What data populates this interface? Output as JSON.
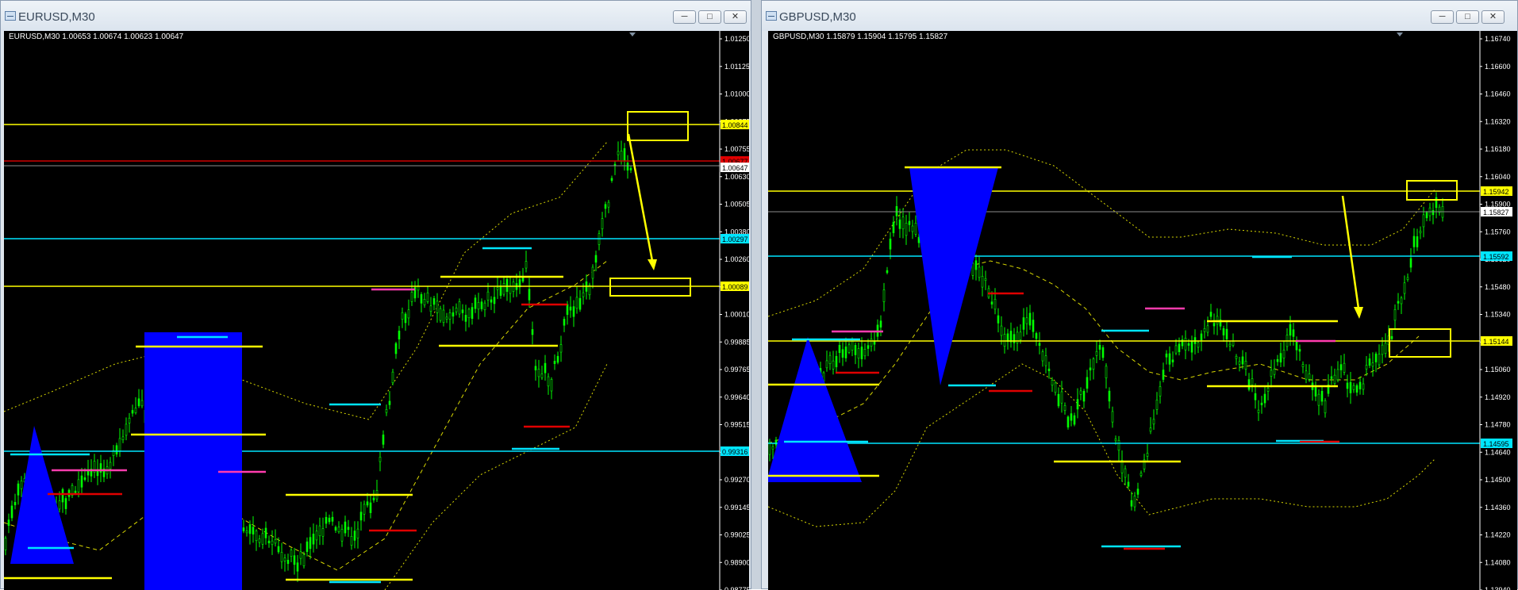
{
  "left": {
    "window_title": "EURUSD,M30",
    "info": "EURUSD,M30  1.00653 1.00674 1.00623 1.00647",
    "min_label": "─",
    "max_label": "□",
    "close_label": "✕",
    "ticks": [
      "1.01250",
      "1.01125",
      "1.01000",
      "1.00875",
      "1.00755",
      "1.00630",
      "1.00505",
      "1.00380",
      "1.00260",
      "1.00135",
      "1.00010",
      "0.99885",
      "0.99765",
      "0.99640",
      "0.99515",
      "0.99390",
      "0.99270",
      "0.99145",
      "0.99025",
      "0.98900",
      "0.98775"
    ],
    "labels": {
      "resistance": "1.00844",
      "red": "1.00677",
      "current": "1.00647",
      "cyan": "1.00297",
      "support": "1.00089",
      "cyan_low": "0.99316"
    },
    "colors": {
      "bull": "#00ff00",
      "yellow": "#ffff00",
      "cyan": "#00e5ff",
      "red": "#e00000",
      "magenta": "#ff3cae",
      "blue": "#0000ff"
    }
  },
  "right": {
    "window_title": "GBPUSD,M30",
    "info": "GBPUSD,M30  1.15879 1.15904 1.15795 1.15827",
    "min_label": "─",
    "max_label": "□",
    "close_label": "✕",
    "ticks": [
      "1.16740",
      "1.16600",
      "1.16460",
      "1.16320",
      "1.16180",
      "1.16040",
      "1.15900",
      "1.15760",
      "1.15620",
      "1.15480",
      "1.15340",
      "1.15200",
      "1.15060",
      "1.14920",
      "1.14780",
      "1.14640",
      "1.14500",
      "1.14360",
      "1.14220",
      "1.14080",
      "1.13940"
    ],
    "labels": {
      "resistance": "1.15942",
      "current": "1.15827",
      "cyan": "1.15592",
      "support": "1.15144",
      "cyan_low": "1.14595"
    }
  }
}
